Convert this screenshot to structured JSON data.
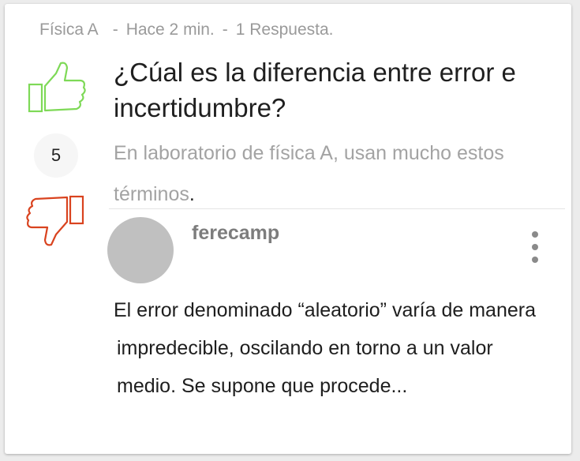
{
  "question": {
    "subject": "Física A",
    "time": "Hace 2 min.",
    "answers": "1 Respuesta.",
    "separator": "-",
    "title": "¿Cúal es la diferencia entre error e incertidumbre?",
    "description": "En laboratorio de física A, usan mucho estos términos",
    "description_end": "."
  },
  "votes": {
    "score": "5",
    "up_icon": "thumbs-up-icon",
    "down_icon": "thumbs-down-icon",
    "up_color": "#7ed957",
    "down_color": "#d9431f"
  },
  "answer": {
    "username": "ferecamp",
    "text": " El error denominado “aleatorio” varía de manera impredecible, oscilando en torno a un valor medio. Se supone que procede..."
  },
  "menu": {
    "icon": "more-vertical-icon"
  }
}
